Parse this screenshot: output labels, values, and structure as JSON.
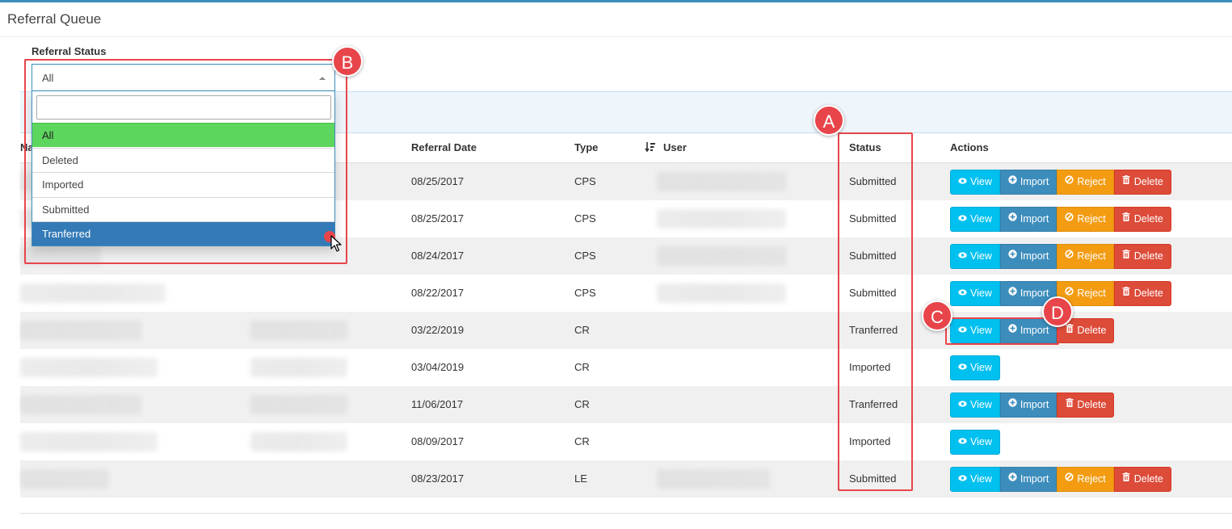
{
  "page": {
    "title": "Referral Queue"
  },
  "filter": {
    "label": "Referral Status",
    "selected": "All",
    "search_placeholder": "",
    "options": [
      {
        "label": "All",
        "state": "selected"
      },
      {
        "label": "Deleted",
        "state": ""
      },
      {
        "label": "Imported",
        "state": ""
      },
      {
        "label": "Submitted",
        "state": ""
      },
      {
        "label": "Tranferred",
        "state": "hovered"
      }
    ]
  },
  "table": {
    "headers": {
      "name": "Na",
      "referral_date": "Referral Date",
      "type": "Type",
      "user": "User",
      "status": "Status",
      "actions": "Actions"
    },
    "rows": [
      {
        "date": "08/25/2017",
        "type": "CPS",
        "status": "Submitted"
      },
      {
        "date": "08/25/2017",
        "type": "CPS",
        "status": "Submitted"
      },
      {
        "date": "08/24/2017",
        "type": "CPS",
        "status": "Submitted"
      },
      {
        "date": "08/22/2017",
        "type": "CPS",
        "status": "Submitted"
      },
      {
        "date": "03/22/2019",
        "type": "CR",
        "status": "Tranferred"
      },
      {
        "date": "03/04/2019",
        "type": "CR",
        "status": "Imported"
      },
      {
        "date": "11/06/2017",
        "type": "CR",
        "status": "Tranferred"
      },
      {
        "date": "08/09/2017",
        "type": "CR",
        "status": "Imported"
      },
      {
        "date": "08/23/2017",
        "type": "LE",
        "status": "Submitted"
      }
    ]
  },
  "buttons": {
    "view": "View",
    "import": "Import",
    "reject": "Reject",
    "delete": "Delete"
  },
  "icons": {
    "view": "eye-icon",
    "import": "plus-circle-icon",
    "reject": "ban-icon",
    "delete": "trash-icon",
    "sort": "sort-amount-icon"
  },
  "annotations": {
    "a": "A",
    "b": "B",
    "c": "C",
    "d": "D"
  },
  "colors": {
    "view": "#00c0ef",
    "import": "#3c8dbc",
    "reject": "#f39c12",
    "delete": "#dd4b39",
    "annotation": "#e8454b",
    "selected_option": "#5cd65c",
    "hover_option": "#337ab7"
  }
}
